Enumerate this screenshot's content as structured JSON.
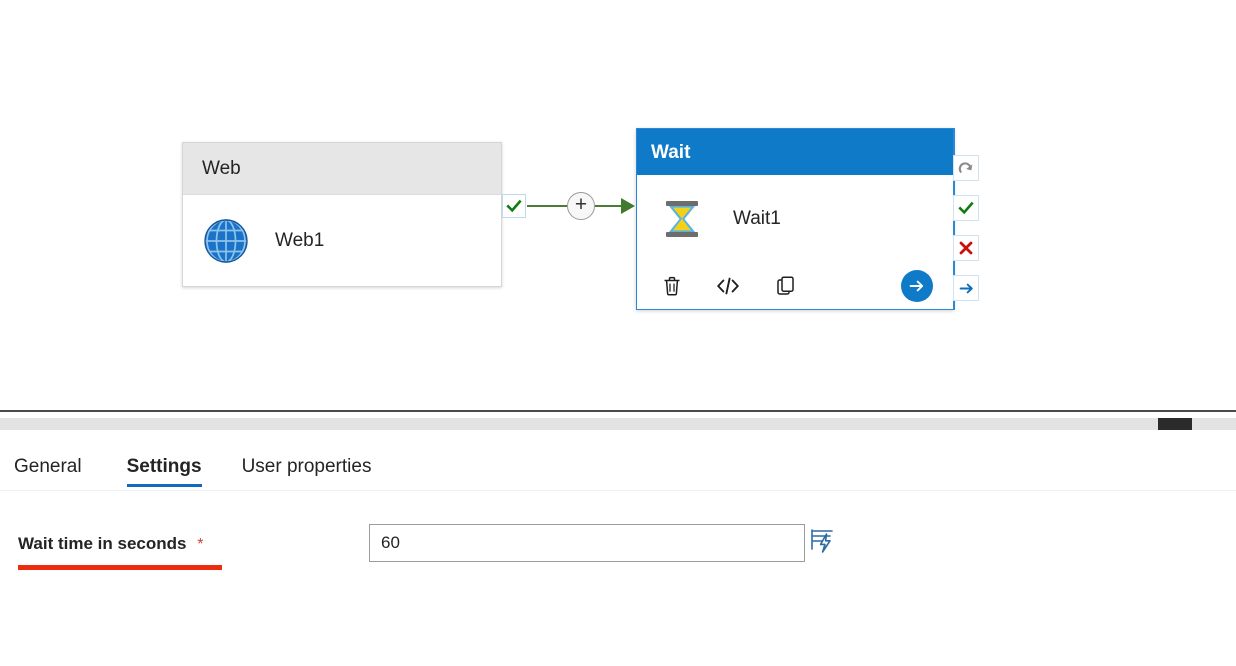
{
  "canvas": {
    "web_activity": {
      "type_label": "Web",
      "name": "Web1",
      "icon": "globe-icon"
    },
    "wait_activity": {
      "type_label": "Wait",
      "name": "Wait1",
      "icon": "hourglass-icon",
      "actions": [
        {
          "name": "delete-activity-icon",
          "label": "Delete"
        },
        {
          "name": "code-view-icon",
          "label": "</>"
        },
        {
          "name": "clone-activity-icon",
          "label": "Clone"
        }
      ],
      "run_button": {
        "name": "run-activity-icon",
        "label": "Debug run"
      },
      "output_connectors": [
        {
          "name": "on-skip-connector-icon",
          "state": "skipped"
        },
        {
          "name": "on-success-connector-icon",
          "state": "success"
        },
        {
          "name": "on-failure-connector-icon",
          "state": "failure"
        },
        {
          "name": "on-completion-connector-icon",
          "state": "completion"
        }
      ]
    },
    "connector": {
      "source_status": "success",
      "add_label": "+"
    }
  },
  "panel": {
    "tabs": [
      {
        "label": "General",
        "active": false
      },
      {
        "label": "Settings",
        "active": true
      },
      {
        "label": "User properties",
        "active": false
      }
    ],
    "settings": {
      "field_label": "Wait time in seconds",
      "required_marker": "*",
      "value": "60",
      "placeholder": "",
      "dynamic_content_icon": "dynamic-content-icon"
    }
  },
  "colors": {
    "accent_blue": "#0f7ac8",
    "tab_underline": "#0f6cbd",
    "success_green": "#107c10",
    "failure_red": "#c9100f",
    "annotation_red": "#ee2c0d",
    "connector_green": "#4c7a37",
    "header_gray": "#e6e6e6"
  }
}
